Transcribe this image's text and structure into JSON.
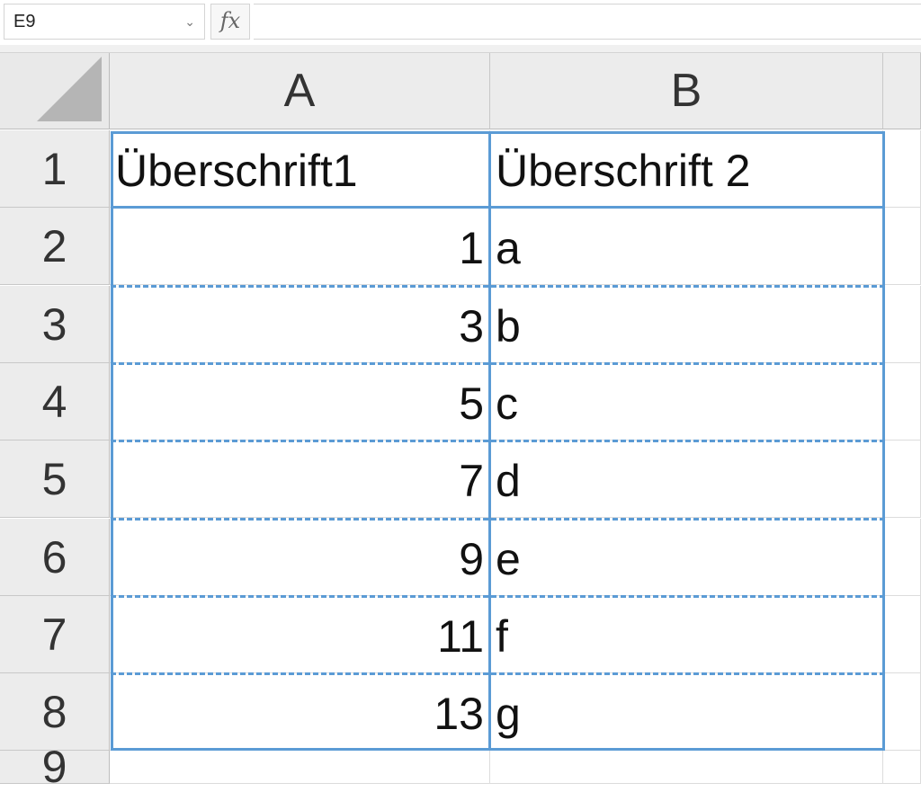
{
  "namebox": {
    "value": "E9",
    "dropdown_icon": "chevron-down-icon"
  },
  "formula_bar": {
    "fx_label": "fx",
    "value": ""
  },
  "columns": [
    "A",
    "B"
  ],
  "rows": [
    {
      "num": "1",
      "a": "Überschrift1",
      "b": "Überschrift 2"
    },
    {
      "num": "2",
      "a": "1",
      "b": "a"
    },
    {
      "num": "3",
      "a": "3",
      "b": "b"
    },
    {
      "num": "4",
      "a": "5",
      "b": "c"
    },
    {
      "num": "5",
      "a": "7",
      "b": "d"
    },
    {
      "num": "6",
      "a": "9",
      "b": "e"
    },
    {
      "num": "7",
      "a": "11",
      "b": "f"
    },
    {
      "num": "8",
      "a": "13",
      "b": "g"
    },
    {
      "num": "9",
      "a": "",
      "b": ""
    }
  ],
  "colors": {
    "table_border": "#5b9bd5",
    "header_bg": "#ececec",
    "grid": "#dcdcdc"
  }
}
